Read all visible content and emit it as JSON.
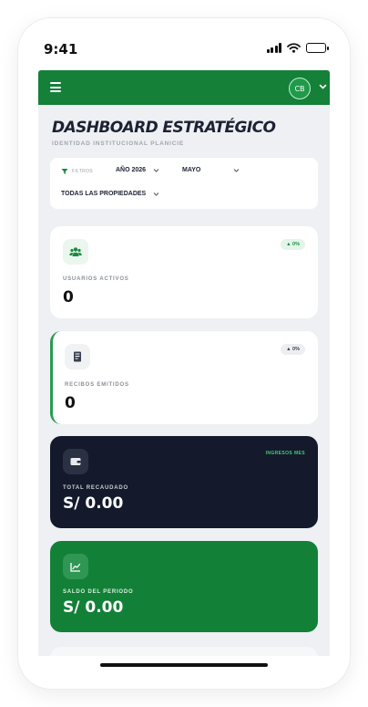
{
  "status": {
    "time": "9:41"
  },
  "header": {
    "avatar_initials": "CB"
  },
  "page": {
    "title": "DASHBOARD ESTRATÉGICO",
    "subtitle": "IDENTIDAD INSTITUCIONAL PLANICIE"
  },
  "filters": {
    "label": "FILTROS",
    "year": "AÑO 2026",
    "month": "MAYO",
    "property": "TODAS LAS PROPIEDADES"
  },
  "cards": [
    {
      "label": "USUARIOS ACTIVOS",
      "value": "0",
      "badge": "▲ 0%",
      "icon": "users-icon"
    },
    {
      "label": "RECIBOS EMITIDOS",
      "value": "0",
      "badge": "▲ 0%",
      "icon": "receipt-icon"
    },
    {
      "label": "TOTAL RECAUDADO",
      "value": "S/ 0.00",
      "badge": "INGRESOS MES",
      "icon": "wallet-icon"
    },
    {
      "label": "SALDO DEL PERIODO",
      "value": "S/ 0.00",
      "icon": "chart-line-icon"
    }
  ],
  "colors": {
    "brand_green": "#148038",
    "dark_card": "#141a2b",
    "badge_green": "#2a9a52"
  }
}
